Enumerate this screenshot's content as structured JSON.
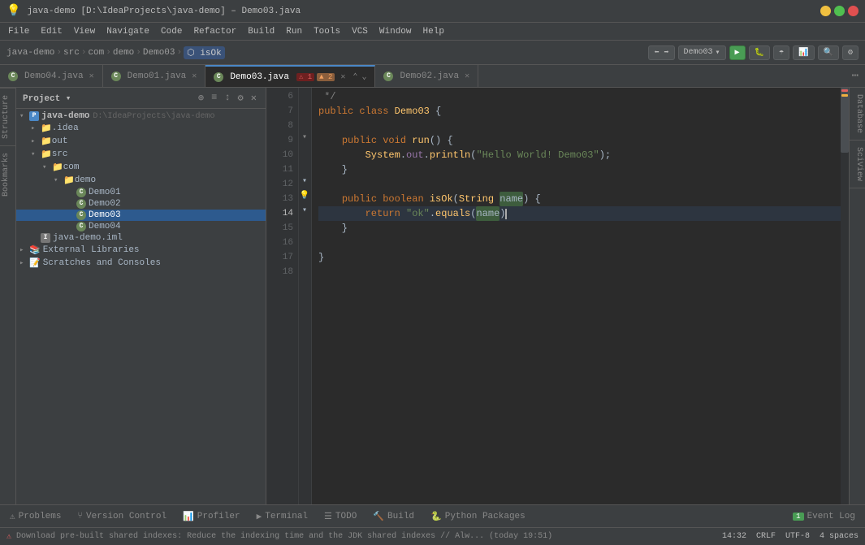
{
  "titleBar": {
    "title": "java-demo [D:\\IdeaProjects\\java-demo] – Demo03.java",
    "minBtn": "─",
    "maxBtn": "□",
    "closeBtn": "✕"
  },
  "menuBar": {
    "items": [
      "File",
      "Edit",
      "View",
      "Navigate",
      "Code",
      "Refactor",
      "Build",
      "Run",
      "Tools",
      "VCS",
      "Window",
      "Help"
    ]
  },
  "navBar": {
    "breadcrumb": [
      "java-demo",
      "src",
      "com",
      "demo",
      "Demo03",
      "isOk"
    ],
    "runConfig": "Demo03",
    "searchIcon": "🔍",
    "gearIcon": "⚙"
  },
  "tabs": [
    {
      "label": "Demo04.java",
      "icon": "C",
      "active": false,
      "hasClose": true
    },
    {
      "label": "Demo01.java",
      "icon": "C",
      "active": false,
      "hasClose": true
    },
    {
      "label": "Demo03.java",
      "icon": "C",
      "active": true,
      "hasClose": true,
      "errors": 1,
      "warnings": 2
    },
    {
      "label": "Demo02.java",
      "icon": "C",
      "active": false,
      "hasClose": true
    }
  ],
  "sidebar": {
    "title": "Project",
    "tree": [
      {
        "label": "java-demo",
        "type": "root",
        "indent": 0,
        "expanded": true,
        "sub": "D:\\IdeaProjects\\java-demo"
      },
      {
        "label": ".idea",
        "type": "folder",
        "indent": 1,
        "expanded": false
      },
      {
        "label": "out",
        "type": "folder",
        "indent": 1,
        "expanded": false,
        "selected_parent": true
      },
      {
        "label": "src",
        "type": "folder",
        "indent": 1,
        "expanded": true
      },
      {
        "label": "com",
        "type": "folder",
        "indent": 2,
        "expanded": true
      },
      {
        "label": "demo",
        "type": "folder",
        "indent": 3,
        "expanded": true
      },
      {
        "label": "Demo01",
        "type": "class",
        "indent": 4
      },
      {
        "label": "Demo02",
        "type": "class",
        "indent": 4
      },
      {
        "label": "Demo03",
        "type": "class",
        "indent": 4,
        "selected": true
      },
      {
        "label": "Demo04",
        "type": "class",
        "indent": 4
      },
      {
        "label": "java-demo.iml",
        "type": "iml",
        "indent": 1
      },
      {
        "label": "External Libraries",
        "type": "folder",
        "indent": 0,
        "expanded": false
      },
      {
        "label": "Scratches and Consoles",
        "type": "folder",
        "indent": 0,
        "expanded": false
      }
    ]
  },
  "editor": {
    "lines": [
      {
        "num": 6,
        "content": " */",
        "type": "comment"
      },
      {
        "num": 7,
        "content": "public class Demo03 {",
        "type": "code"
      },
      {
        "num": 8,
        "content": "",
        "type": "blank"
      },
      {
        "num": 9,
        "content": "    public void run() {",
        "type": "code",
        "foldable": true
      },
      {
        "num": 10,
        "content": "        System.out.println(\"Hello World! Demo03\");",
        "type": "code"
      },
      {
        "num": 11,
        "content": "    }",
        "type": "code"
      },
      {
        "num": 12,
        "content": "",
        "type": "blank"
      },
      {
        "num": 13,
        "content": "    public boolean isOk(String name) {",
        "type": "code",
        "foldable": true
      },
      {
        "num": 14,
        "content": "        return \"ok\".equals(name)",
        "type": "code",
        "current": true,
        "hint": true
      },
      {
        "num": 15,
        "content": "    }",
        "type": "code",
        "foldable": true
      },
      {
        "num": 16,
        "content": "",
        "type": "blank"
      },
      {
        "num": 17,
        "content": "}",
        "type": "code"
      },
      {
        "num": 18,
        "content": "",
        "type": "blank"
      }
    ]
  },
  "bottomTabs": [
    {
      "label": "Problems",
      "icon": "⚠",
      "active": false
    },
    {
      "label": "Version Control",
      "icon": "🔀",
      "active": false
    },
    {
      "label": "Profiler",
      "icon": "📊",
      "active": false
    },
    {
      "label": "Terminal",
      "icon": "▶",
      "active": false
    },
    {
      "label": "TODO",
      "icon": "☰",
      "active": false
    },
    {
      "label": "Build",
      "icon": "🔨",
      "active": false
    },
    {
      "label": "Python Packages",
      "icon": "📦",
      "active": false
    }
  ],
  "eventLog": {
    "label": "Event Log",
    "badge": "1"
  },
  "statusBar": {
    "errorMsg": "Download pre-built shared indexes: Reduce the indexing time and the JDK shared indexes // Alw... (today 19:51)",
    "position": "14:32",
    "lineSep": "CRLF",
    "encoding": "UTF-8",
    "indent": "4 spaces"
  },
  "sidePanels": [
    "Structure",
    "Bookmarks"
  ],
  "rightPanels": [
    "Database",
    "SciView"
  ]
}
